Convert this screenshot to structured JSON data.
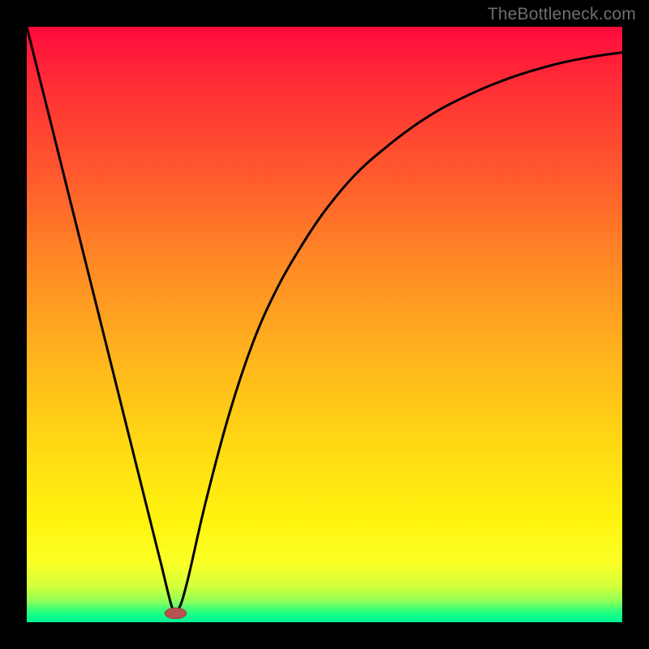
{
  "watermark": "TheBottleneck.com",
  "chart_data": {
    "type": "line",
    "title": "",
    "xlabel": "",
    "ylabel": "",
    "xlim": [
      0,
      100
    ],
    "ylim": [
      0,
      100
    ],
    "grid": false,
    "legend": false,
    "series": [
      {
        "name": "bottleneck-curve",
        "x": [
          0,
          4,
          8,
          12,
          16,
          20,
          22.5,
          24.5,
          25.5,
          27,
          30,
          34,
          38,
          42,
          46,
          50,
          55,
          60,
          66,
          72,
          80,
          88,
          94,
          100
        ],
        "y": [
          100,
          84,
          68,
          52,
          36,
          20,
          10,
          2.2,
          2.2,
          7,
          20,
          35,
          47,
          56,
          63,
          69,
          75,
          79.5,
          84,
          87.5,
          91,
          93.5,
          94.8,
          95.7
        ]
      }
    ],
    "marker": {
      "name": "optimal-point",
      "x": 25,
      "y": 1.5,
      "rx": 1.8,
      "ry": 0.9,
      "color": "#b85252"
    },
    "gradient_stops": [
      {
        "pos": 0,
        "color": "#ff0a3c"
      },
      {
        "pos": 0.55,
        "color": "#ffb31d"
      },
      {
        "pos": 0.83,
        "color": "#fff40e"
      },
      {
        "pos": 0.97,
        "color": "#8dff57"
      },
      {
        "pos": 1.0,
        "color": "#06f08e"
      }
    ]
  }
}
